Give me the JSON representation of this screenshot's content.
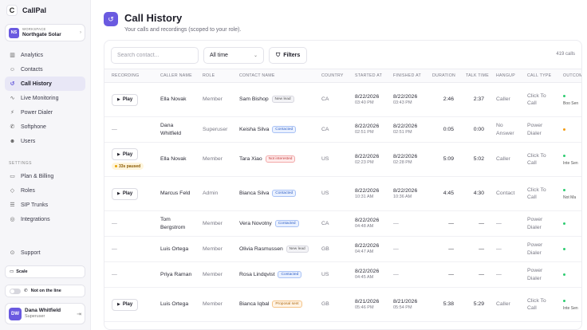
{
  "brand": {
    "name": "CallPal",
    "logo_glyph": "C"
  },
  "workspace": {
    "label": "WORKSPACE",
    "name": "Northgate Solar",
    "initials": "NS"
  },
  "nav": [
    {
      "label": "Analytics",
      "icon": "chart-bar-icon",
      "glyph": "▥"
    },
    {
      "label": "Contacts",
      "icon": "contacts-icon",
      "glyph": "☺"
    },
    {
      "label": "Call History",
      "icon": "history-icon",
      "glyph": "↺",
      "active": true
    },
    {
      "label": "Live Monitoring",
      "icon": "pulse-icon",
      "glyph": "∿"
    },
    {
      "label": "Power Dialer",
      "icon": "dialer-icon",
      "glyph": "⚡"
    },
    {
      "label": "Softphone",
      "icon": "phone-icon",
      "glyph": "✆"
    },
    {
      "label": "Users",
      "icon": "users-icon",
      "glyph": "☻"
    }
  ],
  "settings_label": "SETTINGS",
  "settings_nav": [
    {
      "label": "Plan & Billing",
      "icon": "card-icon",
      "glyph": "▭"
    },
    {
      "label": "Roles",
      "icon": "shield-icon",
      "glyph": "◇"
    },
    {
      "label": "SIP Trunks",
      "icon": "server-icon",
      "glyph": "☰"
    },
    {
      "label": "Integrations",
      "icon": "globe-icon",
      "glyph": "◎"
    }
  ],
  "support": {
    "label": "Support",
    "glyph": "⊙"
  },
  "plan": {
    "label": "Scale",
    "glyph": "▭"
  },
  "line_status": {
    "label": "Not on the line",
    "glyph": "✆"
  },
  "user": {
    "name": "Dana Whitfield",
    "role": "Superuser",
    "initials": "DW"
  },
  "page": {
    "title": "Call History",
    "subtitle": "Your calls and recordings (scoped to your role).",
    "icon_glyph": "↺"
  },
  "toolbar": {
    "search_placeholder": "Search contact...",
    "range": "All time",
    "filters_label": "Filters",
    "count": "419 calls"
  },
  "columns": [
    "RECORDING",
    "CALLER NAME",
    "ROLE",
    "CONTACT NAME",
    "COUNTRY",
    "STARTED AT",
    "FINISHED AT",
    "DURATION",
    "TALK TIME",
    "HANGUP",
    "CALL TYPE",
    "OUTCOME"
  ],
  "play_label": "Play",
  "rows": [
    {
      "recording": "play",
      "caller": "Ella Novak",
      "role": "Member",
      "contact": "Sam Bishop",
      "status": "New lead",
      "status_kind": "new",
      "country": "CA",
      "started_date": "8/22/2026",
      "started_time": "03:40 PM",
      "finished_date": "8/22/2026",
      "finished_time": "03:43 PM",
      "duration": "2:46",
      "talk": "2:37",
      "hangup": "Caller",
      "call_type": "Click To Call",
      "outcome": "Boo Sen",
      "outcome_dot": "green"
    },
    {
      "recording": "none",
      "caller": "Dana Whitfield",
      "role": "Superuser",
      "contact": "Keisha Silva",
      "status": "Contacted",
      "status_kind": "contacted",
      "country": "CA",
      "started_date": "8/22/2026",
      "started_time": "02:51 PM",
      "finished_date": "8/22/2026",
      "finished_time": "02:51 PM",
      "duration": "0:05",
      "talk": "0:00",
      "hangup": "No Answer",
      "call_type": "Power Dialer",
      "outcome": "",
      "outcome_dot": "orange"
    },
    {
      "recording": "paused",
      "paused_label": "33s paused",
      "caller": "Ella Novak",
      "role": "Member",
      "contact": "Tara Xiao",
      "status": "Not interested",
      "status_kind": "notint",
      "country": "US",
      "started_date": "8/22/2026",
      "started_time": "02:23 PM",
      "finished_date": "8/22/2026",
      "finished_time": "02:28 PM",
      "duration": "5:09",
      "talk": "5:02",
      "hangup": "Caller",
      "call_type": "Click To Call",
      "outcome": "Inte Sen",
      "outcome_dot": "green"
    },
    {
      "recording": "play",
      "caller": "Marcus Feld",
      "role": "Admin",
      "contact": "Bianca Silva",
      "status": "Contacted",
      "status_kind": "contacted",
      "country": "US",
      "started_date": "8/22/2026",
      "started_time": "10:31 AM",
      "finished_date": "8/22/2026",
      "finished_time": "10:36 AM",
      "duration": "4:45",
      "talk": "4:30",
      "hangup": "Contact",
      "call_type": "Click To Call",
      "outcome": "Not Ma",
      "outcome_dot": "green"
    },
    {
      "recording": "none",
      "caller": "Tom Bergstrom",
      "role": "Member",
      "contact": "Vera Novotny",
      "status": "Contacted",
      "status_kind": "contacted",
      "country": "CA",
      "started_date": "8/22/2026",
      "started_time": "04:48 AM",
      "finished_date": "—",
      "finished_time": "",
      "duration": "—",
      "talk": "—",
      "hangup": "—",
      "call_type": "Power Dialer",
      "outcome": "",
      "outcome_dot": "green"
    },
    {
      "recording": "none",
      "caller": "Luis Ortega",
      "role": "Member",
      "contact": "Olivia Rasmussen",
      "status": "New lead",
      "status_kind": "new",
      "country": "GB",
      "started_date": "8/22/2026",
      "started_time": "04:47 AM",
      "finished_date": "—",
      "finished_time": "",
      "duration": "—",
      "talk": "—",
      "hangup": "—",
      "call_type": "Power Dialer",
      "outcome": "",
      "outcome_dot": "green"
    },
    {
      "recording": "none",
      "caller": "Priya Raman",
      "role": "Member",
      "contact": "Rosa Lindqvist",
      "status": "Contacted",
      "status_kind": "contacted",
      "country": "US",
      "started_date": "8/22/2026",
      "started_time": "04:45 AM",
      "finished_date": "—",
      "finished_time": "",
      "duration": "—",
      "talk": "—",
      "hangup": "—",
      "call_type": "Power Dialer",
      "outcome": "",
      "outcome_dot": "green"
    },
    {
      "recording": "play",
      "caller": "Luis Ortega",
      "role": "Member",
      "contact": "Bianca Iqbal",
      "status": "Proposal sent",
      "status_kind": "proposal",
      "country": "GB",
      "started_date": "8/21/2026",
      "started_time": "05:46 PM",
      "finished_date": "8/21/2026",
      "finished_time": "05:54 PM",
      "duration": "5:38",
      "talk": "5:29",
      "hangup": "Caller",
      "call_type": "Click To Call",
      "outcome": "Inte Sen",
      "outcome_dot": "green"
    }
  ],
  "colors": {
    "accent": "#6a5ae0",
    "active_bg": "#e8e7f6"
  }
}
